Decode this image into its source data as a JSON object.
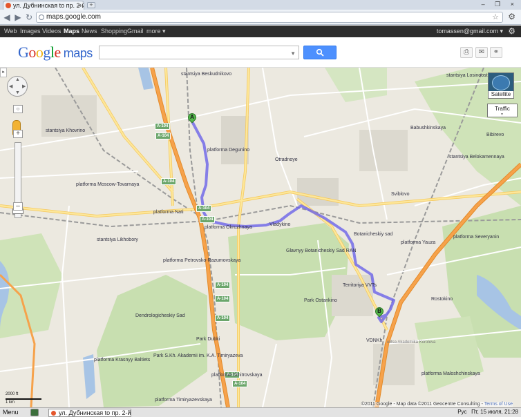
{
  "browser": {
    "tab_title": "ул. Дубнинская to пр. 2-й...",
    "tab_close": "×",
    "new_tab": "+",
    "window_controls": "– ❐ ×",
    "url": "maps.google.com",
    "back": "◀",
    "forward": "▶",
    "reload": "↻",
    "star": "☆",
    "wrench": "⚙"
  },
  "gbar": {
    "links": [
      "Web",
      "Images",
      "Videos",
      "Maps",
      "News",
      "Shopping",
      "Gmail",
      "more ▾"
    ],
    "selected": "Maps",
    "user": "tomassen@gmail.com ▾",
    "gear": "⚙"
  },
  "header": {
    "logo_letters": [
      "G",
      "o",
      "o",
      "g",
      "l",
      "e"
    ],
    "logo_product": "maps",
    "search_value": "",
    "search_button_icon": "search-icon",
    "icons": [
      "print-icon",
      "email-icon",
      "link-icon"
    ]
  },
  "map": {
    "colors": {
      "background": "#ece9e0",
      "park": "#c8dfb0",
      "water": "#a7c4e5",
      "highway": "#f6a24b",
      "major_road": "#fde79a",
      "road": "#ffffff",
      "rail": "#9a9a9a",
      "route": "#6b63e8"
    },
    "controls": {
      "side_toggle": "▸",
      "zoom_in": "+",
      "zoom_out": "–",
      "satellite": "Satellite",
      "traffic": "Traffic"
    },
    "markers": [
      "A",
      "B"
    ],
    "shields": [
      "A-104",
      "A-104",
      "A-104",
      "A-104",
      "A-104",
      "A-104",
      "A-104",
      "A-104",
      "A-104",
      "A-104"
    ],
    "labels": [
      "stantsiya Beskudnikovo",
      "platforma Degunino",
      "stantsiya Khovrino",
      "platforma Moscow-Tovarnaya",
      "platforma Nati",
      "platforma Okruzhnaya",
      "platforma Petrovsko-Razumovskaya",
      "stantsiya Likhobory",
      "Vladykino",
      "Otradnoye",
      "Glavnyy Botanicheskiy Sad RAN",
      "Botanicheskiy sad",
      "Park Ostankino",
      "Territoriya VVTs",
      "VDNKh",
      "ulitsa Akademika Koroleva",
      "Dendrologicheskiy Sad",
      "Park Dubki",
      "Park S.Kh. Akademii im. K.A. Timiryazeva",
      "platforma Krasnyy Baltiets",
      "platforma Dmitrovskaya",
      "platforma Timiryazevskaya",
      "stantsiya Losinoostrovskaya",
      "Babushkinskaya",
      "stantsiya Belokamennaya",
      "Sviblovo",
      "platforma Severyanin",
      "platforma Yauza",
      "Rostokino",
      "Bibirevo",
      "platforma Maloshchinskaya"
    ],
    "scale": {
      "top": "2000 ft",
      "bottom": "1 km"
    },
    "copyright": "©2011 Google - Map data ©2011 Geocentre Consulting -",
    "terms_link": "Terms of Use"
  },
  "taskbar": {
    "menu": "Menu",
    "task_title": "ул. Дубнинская to пр. 2-й...",
    "layout": "Рус",
    "datetime": "Пт, 15 июля, 21:28"
  }
}
